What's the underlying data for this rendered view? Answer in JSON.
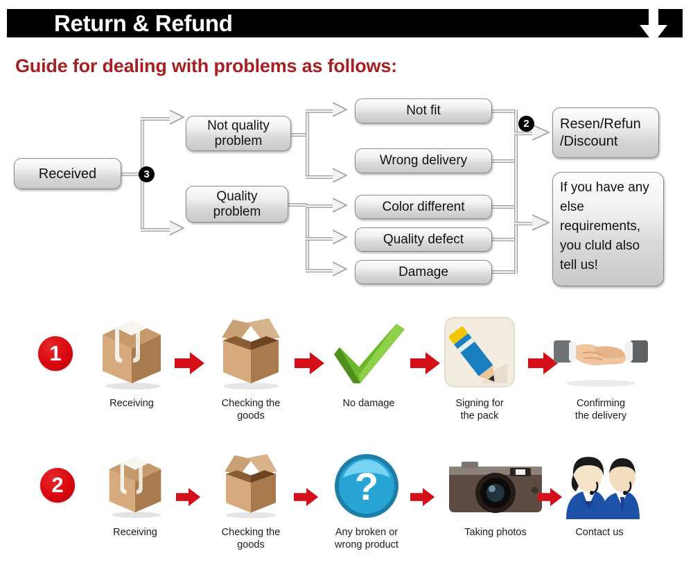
{
  "header": {
    "title": "Return & Refund",
    "arrow_icon": "down-arrow-icon",
    "bar_color": "#000000",
    "title_color": "#ffffff"
  },
  "guide": {
    "title": "Guide for dealing with problems as follows:",
    "color": "#a81f22"
  },
  "flowchart": {
    "markers": [
      {
        "id": "marker-3",
        "label": "3"
      },
      {
        "id": "marker-2",
        "label": "2"
      }
    ],
    "nodes": {
      "received": "Received",
      "not_quality_problem": "Not quality\nproblem",
      "quality_problem": "Quality\nproblem",
      "not_fit": "Not fit",
      "wrong_delivery": "Wrong delivery",
      "color_different": "Color different",
      "quality_defect": "Quality defect",
      "damage": "Damage",
      "resend_refund_discount": "Resen/Refun\n/Discount",
      "else_requirements": "If you have any else requirements, you cluld also tell us!"
    }
  },
  "process_rows": [
    {
      "number": "1",
      "number_color": "#d8070d",
      "steps": [
        {
          "icon": "sealed-box-icon",
          "caption": "Receiving"
        },
        {
          "icon": "open-box-icon",
          "caption": "Checking the\ngoods"
        },
        {
          "icon": "green-check-icon",
          "caption": "No damage"
        },
        {
          "icon": "pencil-sign-icon",
          "caption": "Signing for\nthe pack"
        },
        {
          "icon": "handshake-icon",
          "caption": "Confirming\nthe delivery"
        }
      ]
    },
    {
      "number": "2",
      "number_color": "#d8070d",
      "steps": [
        {
          "icon": "sealed-box-icon",
          "caption": "Receiving"
        },
        {
          "icon": "open-box-icon",
          "caption": "Checking the\ngoods"
        },
        {
          "icon": "question-mark-icon",
          "caption": "Any broken or\nwrong product"
        },
        {
          "icon": "camera-icon",
          "caption": "Taking photos"
        },
        {
          "icon": "support-agents-icon",
          "caption": "Contact us"
        }
      ]
    }
  ],
  "arrow_color": "#d3101a"
}
